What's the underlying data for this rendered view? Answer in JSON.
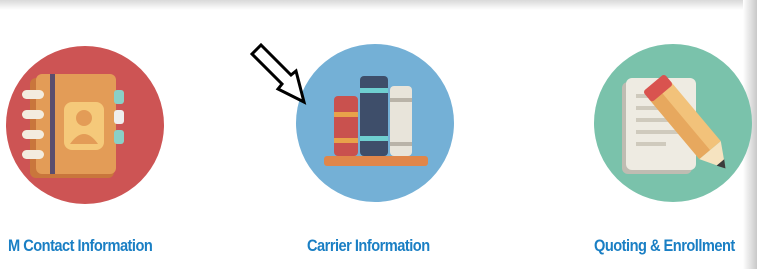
{
  "tiles": [
    {
      "label": "M Contact Information",
      "icon": "address-book-icon",
      "circle_color": "#cd5454"
    },
    {
      "label": "Carrier Information",
      "icon": "books-icon",
      "circle_color": "#74b0d6"
    },
    {
      "label": "Quoting & Enrollment",
      "icon": "notepad-pencil-icon",
      "circle_color": "#7ac2ab"
    }
  ],
  "cursor": {
    "icon": "mouse-pointer-icon"
  },
  "colors": {
    "link": "#1a7fc4"
  }
}
